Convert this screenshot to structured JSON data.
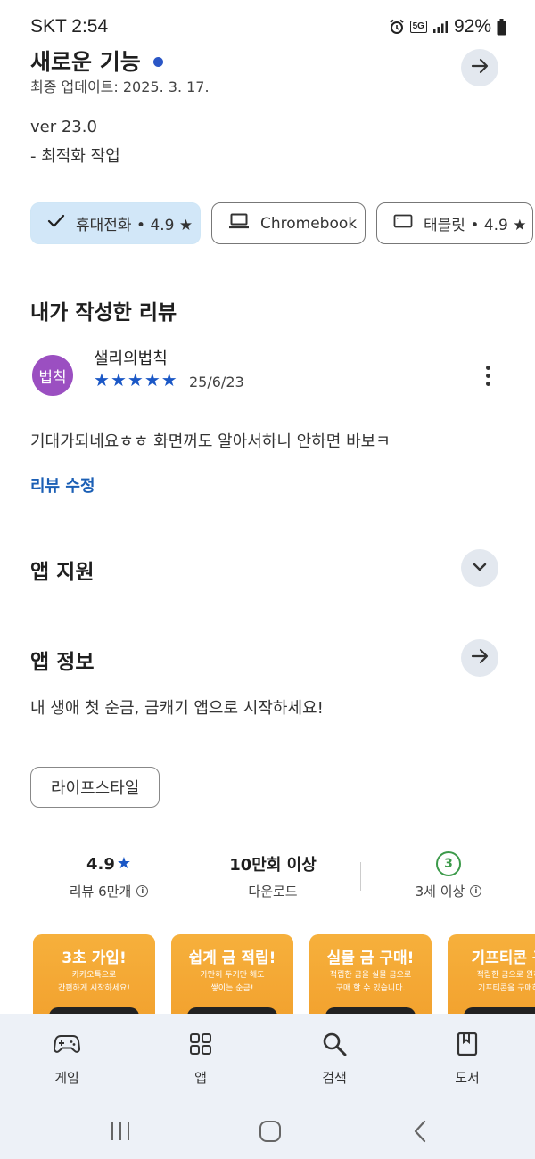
{
  "status_bar": {
    "time": "SKT 2:54",
    "network": "5G",
    "battery": "92%"
  },
  "whats_new": {
    "title": "새로운 기능",
    "updated": "최종 업데이트: 2025. 3. 17.",
    "version": "ver 23.0",
    "notes": "- 최적화 작업",
    "dot_color": "#2a56c6"
  },
  "device_chips": [
    {
      "label": "휴대전화 • 4.9 ★",
      "selected": true,
      "icon": "check-icon"
    },
    {
      "label": "Chromebook",
      "selected": false,
      "icon": "laptop-icon"
    },
    {
      "label": "태블릿 • 4.9 ★",
      "selected": false,
      "icon": "tablet-icon"
    }
  ],
  "my_review": {
    "heading": "내가 작성한 리뷰",
    "avatar_text": "법칙",
    "avatar_color": "#9b4fc1",
    "reviewer": "샐리의법칙",
    "stars": 5,
    "date": "25/6/23",
    "text": "기대가되네요ㅎㅎ 화면꺼도 알아서하니 안하면 바보ㅋ",
    "edit_label": "리뷰 수정"
  },
  "app_support": {
    "heading": "앱 지원"
  },
  "app_info": {
    "heading": "앱 정보",
    "description": "내 생애 첫 순금, 금캐기 앱으로 시작하세요!",
    "category": "라이프스타일"
  },
  "stats": {
    "rating": "4.9",
    "reviews": "리뷰 6만개",
    "downloads": "10만회 이상",
    "downloads_label": "다운로드",
    "age": "3",
    "age_label": "3세 이상"
  },
  "screenshots": [
    {
      "title": "3초 가입!",
      "sub1": "카카오톡으로",
      "sub2": "간편하게 시작하세요!"
    },
    {
      "title": "쉽게 금 적립!",
      "sub1": "가만히 두기만 해도",
      "sub2": "쌓이는 순금!"
    },
    {
      "title": "실물 금 구매!",
      "sub1": "적립한 금을 실물 금으로",
      "sub2": "구매 할 수 있습니다."
    },
    {
      "title": "기프티콘 구",
      "sub1": "적립한 금으로 원하",
      "sub2": "기프티콘을 구매하"
    }
  ],
  "bottom_nav": [
    {
      "label": "게임",
      "icon": "gamepad-icon"
    },
    {
      "label": "앱",
      "icon": "apps-grid-icon"
    },
    {
      "label": "검색",
      "icon": "search-icon"
    },
    {
      "label": "도서",
      "icon": "book-icon"
    }
  ],
  "colors": {
    "accent": "#1b5fb5",
    "star": "#1a57c6",
    "chip_selected_bg": "#d2e7f8",
    "age_green": "#3c9a4a"
  }
}
